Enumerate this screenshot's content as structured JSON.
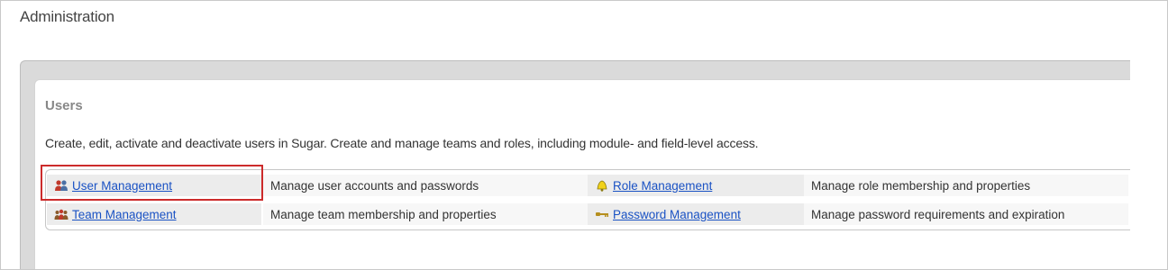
{
  "page": {
    "title": "Administration"
  },
  "users_section": {
    "title": "Users",
    "description": "Create, edit, activate and deactivate users in Sugar. Create and manage teams and roles, including module- and field-level access.",
    "items": [
      {
        "link_label": "User Management",
        "icon": "users-icon",
        "description": "Manage user accounts and passwords"
      },
      {
        "link_label": "Role Management",
        "icon": "bell-icon",
        "description": "Manage role membership and properties"
      },
      {
        "link_label": "Team Management",
        "icon": "team-icon",
        "description": "Manage team membership and properties"
      },
      {
        "link_label": "Password Management",
        "icon": "key-icon",
        "description": "Manage password requirements and expiration"
      }
    ]
  },
  "colors": {
    "link": "#1a52c4",
    "highlight": "#cc2b2b"
  }
}
